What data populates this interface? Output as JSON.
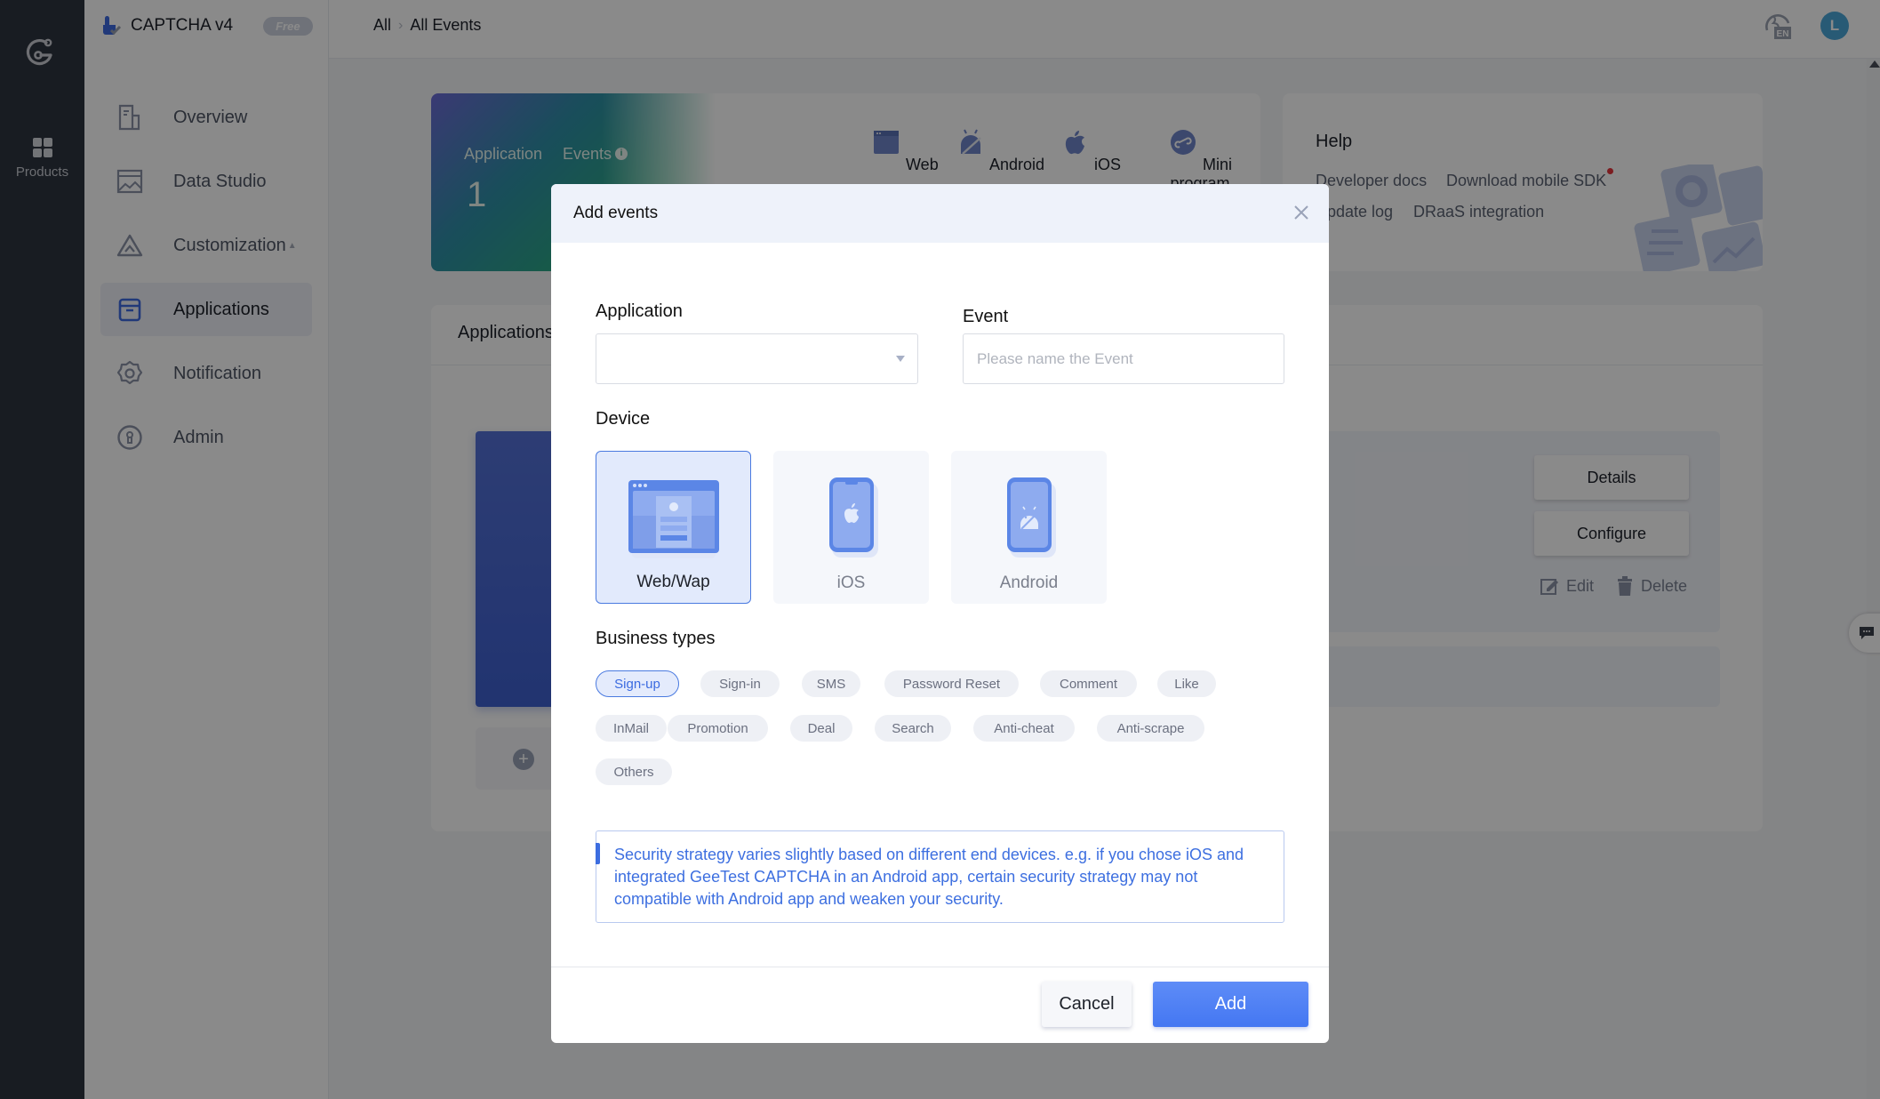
{
  "rail": {
    "products_label": "Products"
  },
  "brand": {
    "name": "CAPTCHA v4",
    "plan_badge": "Free"
  },
  "sidebar": {
    "items": [
      {
        "label": "Overview",
        "icon": "document-icon",
        "active": false
      },
      {
        "label": "Data Studio",
        "icon": "chart-image-icon",
        "active": false
      },
      {
        "label": "Customization",
        "icon": "triangle-icon",
        "active": false,
        "caret": "▲"
      },
      {
        "label": "Applications",
        "icon": "box-icon",
        "active": true
      },
      {
        "label": "Notification",
        "icon": "gear-icon",
        "active": false
      },
      {
        "label": "Admin",
        "icon": "lock-circle-icon",
        "active": false
      }
    ]
  },
  "header": {
    "breadcrumb": [
      "All",
      "All Events"
    ],
    "language": "EN",
    "avatar_initial": "L"
  },
  "stats": {
    "application_label": "Application",
    "events_label": "Events",
    "application_count": "1",
    "platforms": [
      "Web",
      "Android",
      "iOS",
      "Mini program"
    ]
  },
  "help": {
    "title": "Help",
    "links": [
      "Developer docs",
      "Download mobile SDK",
      "Update log",
      "DRaaS integration"
    ]
  },
  "applications": {
    "title": "Applications",
    "buttons": {
      "details": "Details",
      "configure": "Configure",
      "edit": "Edit",
      "delete": "Delete"
    }
  },
  "modal": {
    "title": "Add events",
    "application_label": "Application",
    "application_value": "",
    "event_label": "Event",
    "event_placeholder": "Please name the Event",
    "event_value": "",
    "device_label": "Device",
    "devices": [
      {
        "label": "Web/Wap",
        "selected": true
      },
      {
        "label": "iOS",
        "selected": false
      },
      {
        "label": "Android",
        "selected": false
      }
    ],
    "business_types_label": "Business types",
    "business_types": [
      {
        "label": "Sign-up",
        "selected": true
      },
      {
        "label": "Sign-in",
        "selected": false
      },
      {
        "label": "SMS",
        "selected": false
      },
      {
        "label": "Password Reset",
        "selected": false
      },
      {
        "label": "Comment",
        "selected": false
      },
      {
        "label": "Like",
        "selected": false
      },
      {
        "label": "InMail",
        "selected": false
      },
      {
        "label": "Promotion",
        "selected": false
      },
      {
        "label": "Deal",
        "selected": false
      },
      {
        "label": "Search",
        "selected": false
      },
      {
        "label": "Anti-cheat",
        "selected": false
      },
      {
        "label": "Anti-scrape",
        "selected": false
      },
      {
        "label": "Others",
        "selected": false
      }
    ],
    "notice": "Security strategy varies slightly based on different end devices. e.g. if you chose iOS and integrated GeeTest CAPTCHA in an Android app, certain security strategy may not compatible with Android app and weaken your security.",
    "cancel_label": "Cancel",
    "add_label": "Add"
  },
  "colors": {
    "primary": "#4477f2",
    "selected_bg": "#e2eafc",
    "rail_bg": "#2e3440",
    "notice_text": "#3d6fe0",
    "overlay": "rgba(0,0,0,0.46)"
  }
}
